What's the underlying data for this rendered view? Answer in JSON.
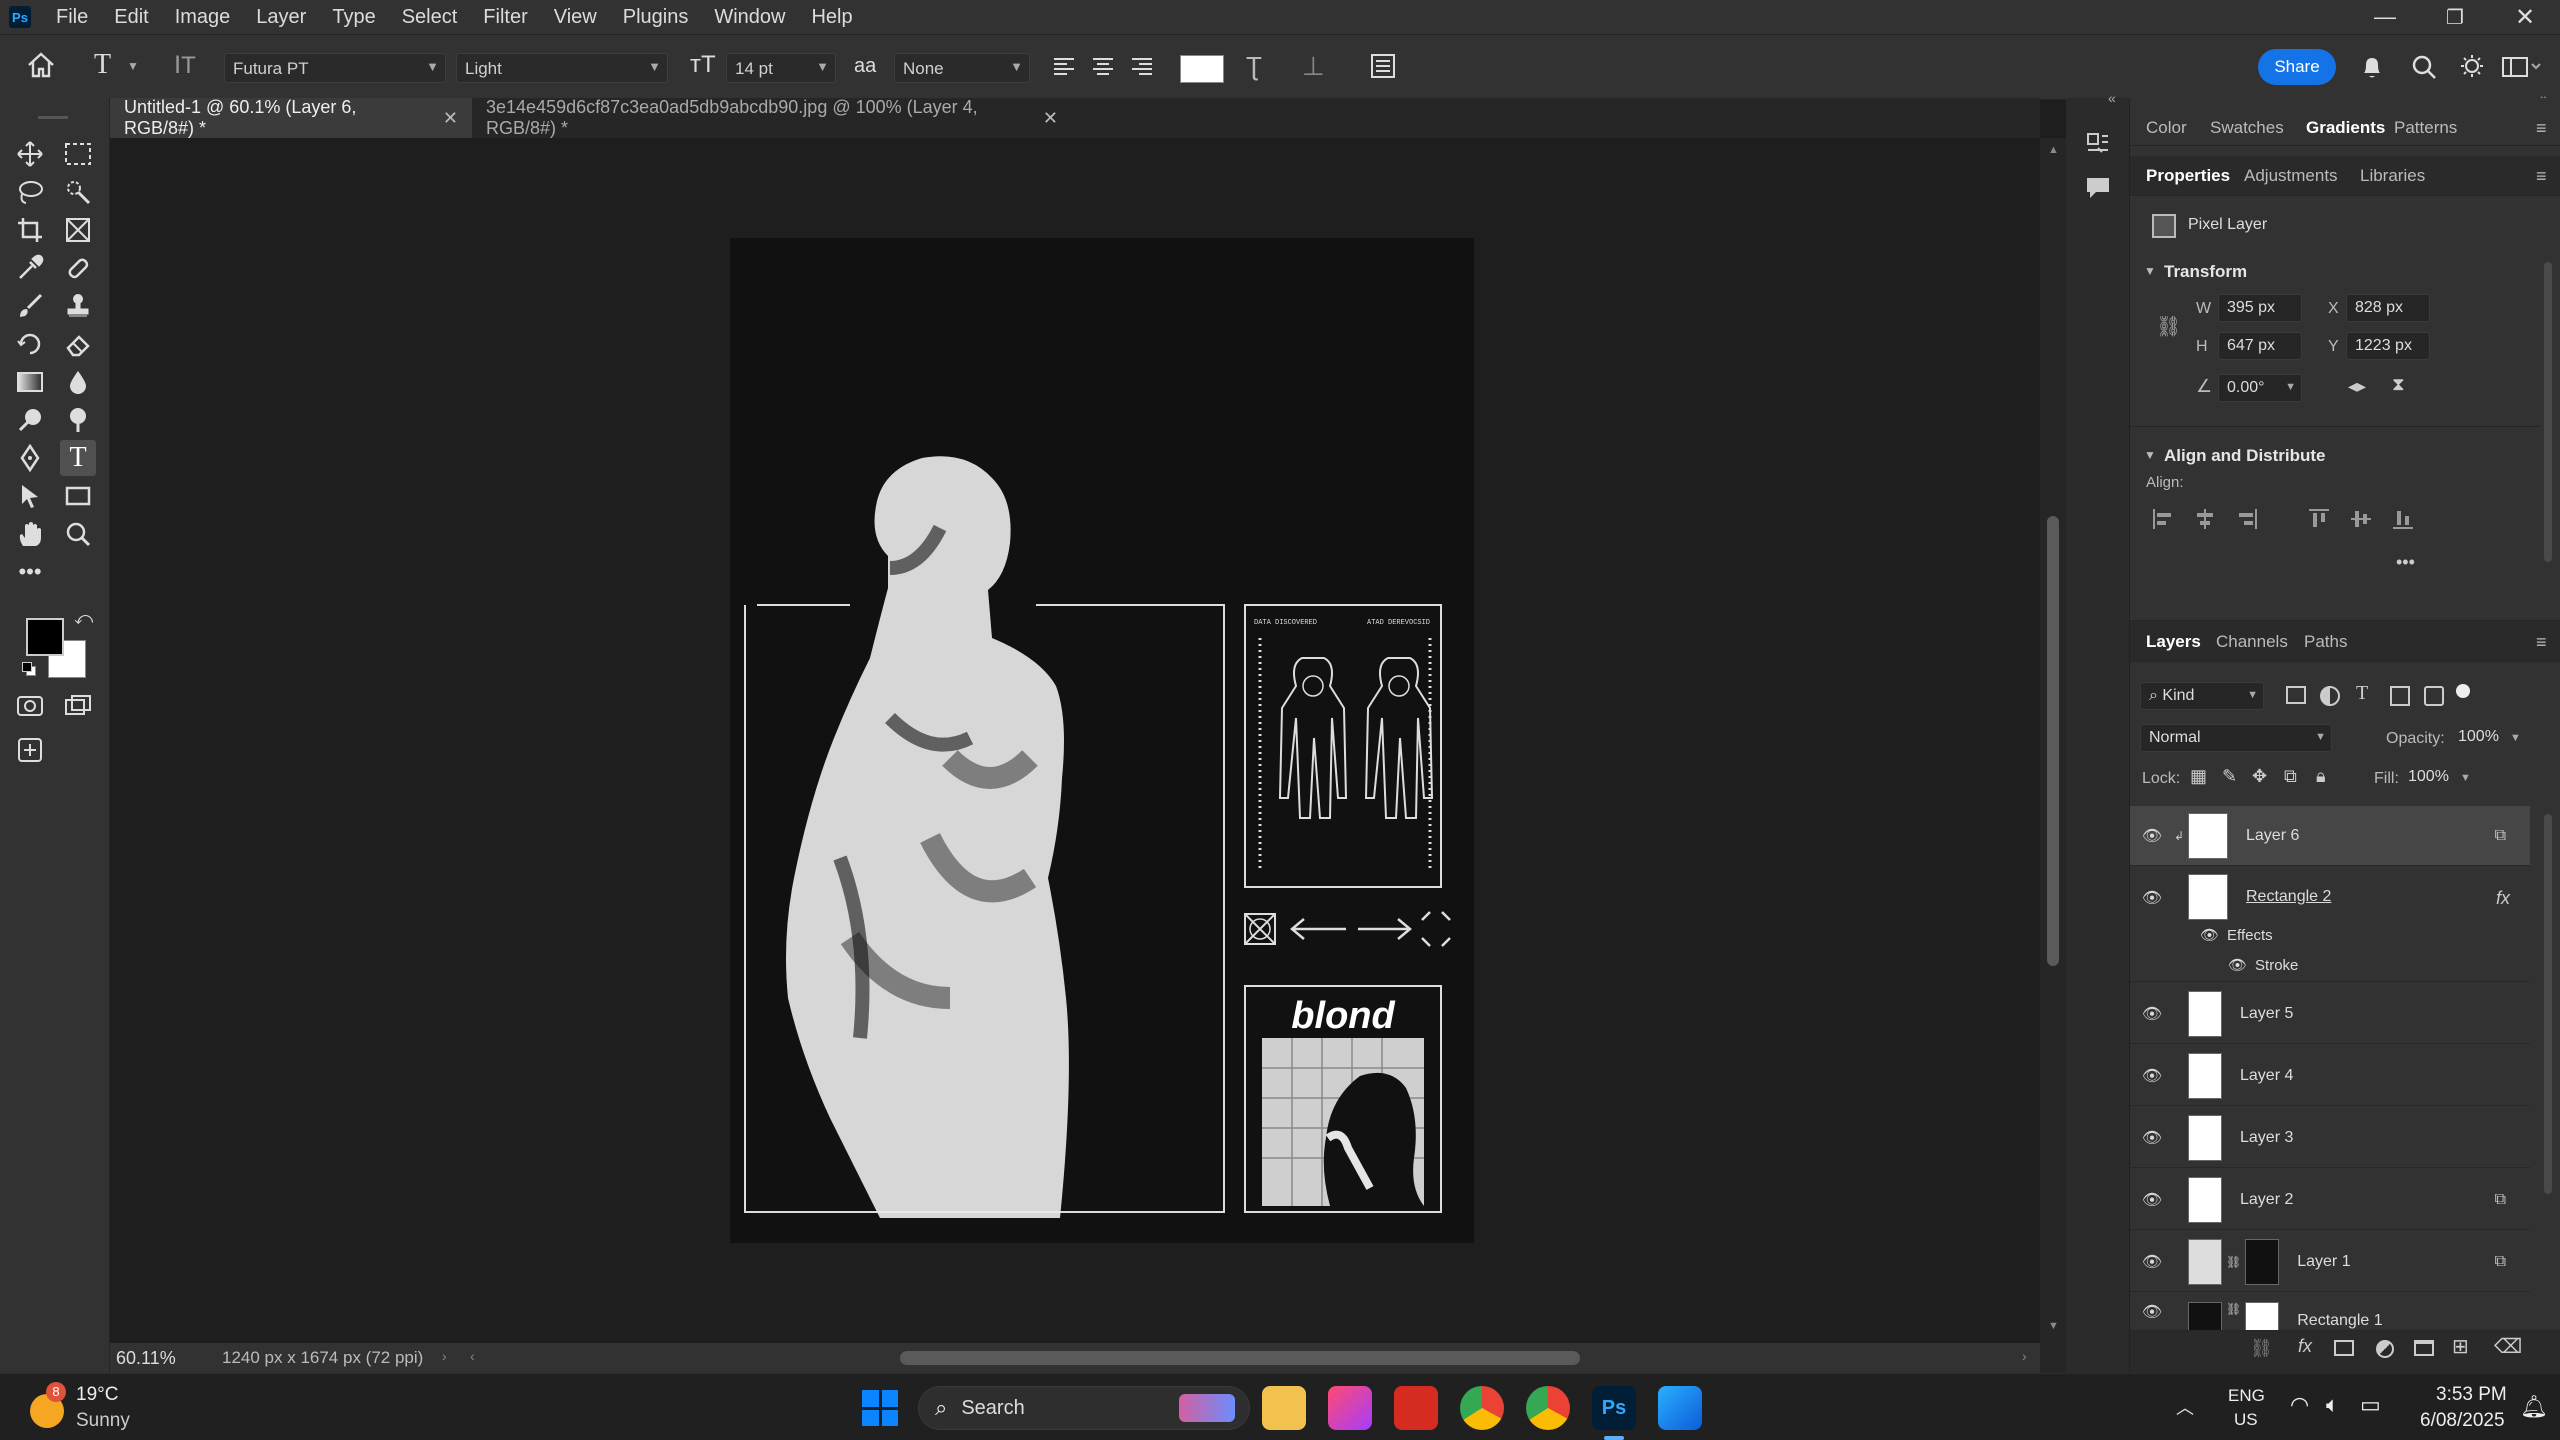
{
  "app": {
    "logo": "Ps",
    "accent": "#1473e6"
  },
  "menu": [
    "File",
    "Edit",
    "Image",
    "Layer",
    "Type",
    "Select",
    "Filter",
    "View",
    "Plugins",
    "Window",
    "Help"
  ],
  "options": {
    "font_family": "Futura PT",
    "font_style": "Light",
    "font_size": "14 pt",
    "aa_icon": "aa",
    "antialias": "None",
    "share": "Share"
  },
  "tabs": [
    {
      "label": "Untitled-1 @ 60.1% (Layer 6, RGB/8#) *",
      "active": true
    },
    {
      "label": "3e14e459d6cf87c3ea0ad5db9abcdb90.jpg @ 100% (Layer 4, RGB/8#) *",
      "active": false
    }
  ],
  "artwork": {
    "title": "blond",
    "label_tl": "DATA DISCOVERED",
    "label_tr": "ATAD DEREVOCSID"
  },
  "status": {
    "zoom": "60.11%",
    "doc_info": "1240 px x 1674 px (72 ppi)"
  },
  "panels": {
    "top_tabs": [
      "Color",
      "Swatches",
      "Gradients",
      "Patterns"
    ],
    "prop_tabs": [
      "Properties",
      "Adjustments",
      "Libraries"
    ],
    "pixel_layer": "Pixel Layer",
    "transform": {
      "title": "Transform",
      "w_label": "W",
      "w": "395 px",
      "x_label": "X",
      "x": "828 px",
      "h_label": "H",
      "h": "647 px",
      "y_label": "Y",
      "y": "1223 px",
      "angle": "0.00°"
    },
    "align": {
      "title": "Align and Distribute",
      "label": "Align:"
    },
    "layer_tabs": [
      "Layers",
      "Channels",
      "Paths"
    ],
    "kind": "Kind",
    "blend": "Normal",
    "opacity_label": "Opacity:",
    "opacity": "100%",
    "lock_label": "Lock:",
    "fill_label": "Fill:",
    "fill": "100%",
    "effects": "Effects",
    "stroke": "Stroke",
    "fx": "fx",
    "layers": [
      "Layer 6",
      "Rectangle 2",
      "Layer 5",
      "Layer 4",
      "Layer 3",
      "Layer 2",
      "Layer 1",
      "Rectangle 1"
    ]
  },
  "taskbar": {
    "badge": "8",
    "temp": "19°C",
    "weather": "Sunny",
    "search": "Search",
    "lang1": "ENG",
    "lang2": "US",
    "time": "3:53 PM",
    "date": "6/08/2025"
  }
}
